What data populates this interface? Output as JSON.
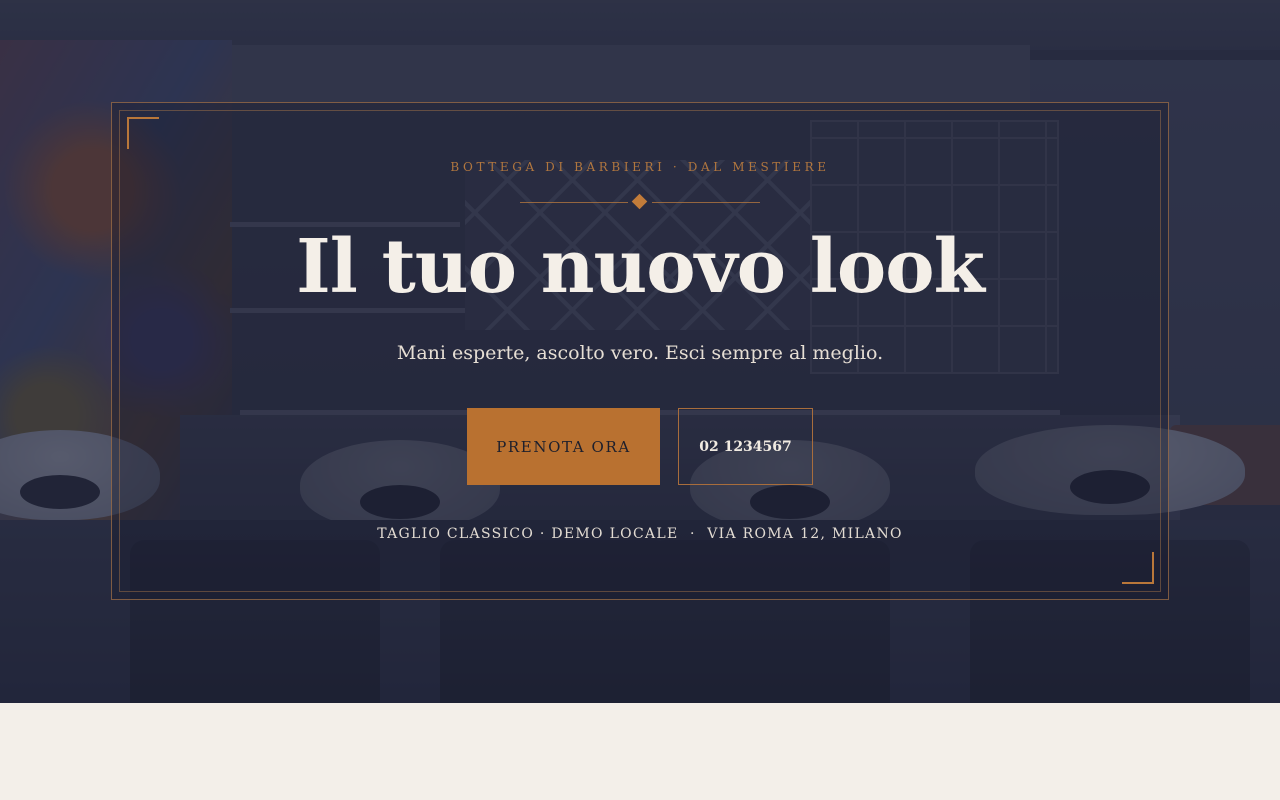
{
  "hero": {
    "kicker": "BOTTEGA DI BARBIERI · DAL MESTIERE",
    "headline": "Il tuo nuovo look",
    "subline": "Mani esperte, ascolto vero. Esci sempre al meglio.",
    "primary_button": "PRENOTA ORA",
    "phone_button": "02 1234567",
    "info_parts": [
      "TAGLIO CLASSICO",
      "DEMO LOCALE",
      "VIA ROMA 12, MILANO"
    ],
    "info_separator": " · "
  },
  "colors": {
    "accent": "#b97130",
    "overlay": "#1c2037",
    "text_light": "#f4efe8",
    "page_background": "#f3efe9"
  },
  "icons": {
    "divider": "diamond-ornament-icon",
    "corners": "corner-bracket-icon"
  }
}
